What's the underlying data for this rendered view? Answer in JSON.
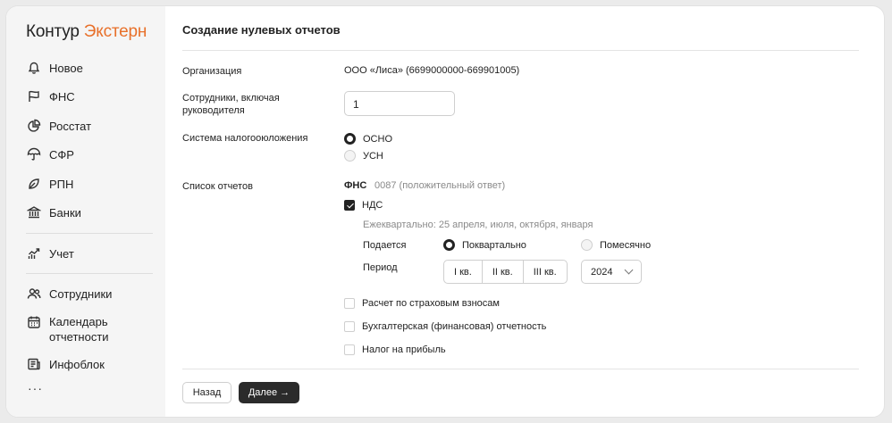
{
  "logo": {
    "part1": "Контур",
    "part2": "Экстерн"
  },
  "sidebar": {
    "items": [
      {
        "label": "Новое",
        "icon": "bell-icon"
      },
      {
        "label": "ФНС",
        "icon": "flag-icon"
      },
      {
        "label": "Росстат",
        "icon": "pie-chart-icon"
      },
      {
        "label": "СФР",
        "icon": "umbrella-icon"
      },
      {
        "label": "РПН",
        "icon": "leaf-icon"
      },
      {
        "label": "Банки",
        "icon": "bank-icon"
      },
      {
        "label": "Учет",
        "icon": "trend-chart-icon"
      },
      {
        "label": "Сотрудники",
        "icon": "people-icon"
      },
      {
        "label": "Календарь отчетности",
        "icon": "calendar-icon"
      },
      {
        "label": "Инфоблок",
        "icon": "newspaper-icon"
      }
    ],
    "more": "···"
  },
  "page": {
    "title": "Создание нулевых отчетов"
  },
  "form": {
    "org_label": "Организация",
    "org_value": "ООО «Лиса» (6699000000-669901005)",
    "employees_label": "Сотрудники, включая руководителя",
    "employees_value": "1",
    "tax_label": "Система налогооюложения",
    "tax_options": [
      "ОСНО",
      "УСН"
    ],
    "tax_selected": "ОСНО",
    "reports_label": "Список отчетов",
    "fns_title": "ФНС",
    "fns_note": "0087 (положительный ответ)",
    "vat_label": "НДС",
    "vat_checked": true,
    "vat_schedule": "Ежеквартально: 25 апреля, июля, октября, января",
    "submit_label": "Подается",
    "submit_options": [
      "Поквартально",
      "Помесячно"
    ],
    "submit_selected": "Поквартально",
    "period_label": "Период",
    "quarters": [
      "I кв.",
      "II кв.",
      "III кв."
    ],
    "year": "2024",
    "other_reports": [
      {
        "label": "Расчет по страховым взносам",
        "checked": false
      },
      {
        "label": "Бухгалтерская (финансовая) отчетность",
        "checked": false
      },
      {
        "label": "Налог на прибыль",
        "checked": false
      }
    ]
  },
  "buttons": {
    "back": "Назад",
    "next": "Далее →"
  },
  "colors": {
    "accent": "#e8702a",
    "primary_button": "#2b2b2b",
    "sidebar_bg": "#f5f5f5"
  }
}
